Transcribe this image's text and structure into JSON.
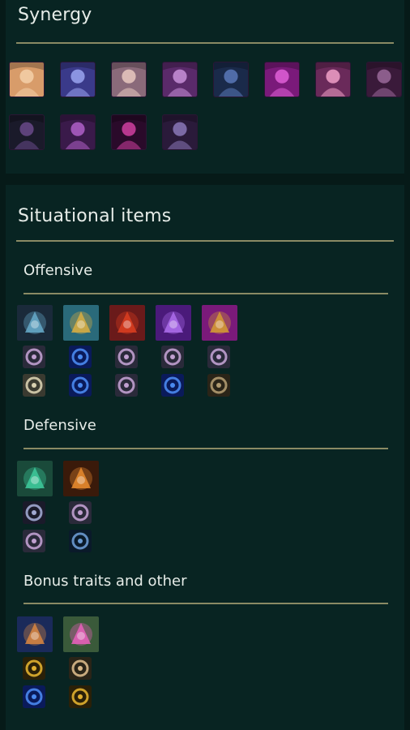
{
  "synergy": {
    "title": "Synergy",
    "champions": [
      {
        "icon": "champion-1-icon",
        "bg": "#d89c6a",
        "accent": "#f4d0a8"
      },
      {
        "icon": "champion-2-icon",
        "bg": "#3a3a8a",
        "accent": "#9aa4f0"
      },
      {
        "icon": "champion-3-icon",
        "bg": "#8a6a7a",
        "accent": "#e8c8c0"
      },
      {
        "icon": "champion-4-icon",
        "bg": "#5a2a6a",
        "accent": "#c890d8"
      },
      {
        "icon": "champion-5-icon",
        "bg": "#1a2a4a",
        "accent": "#5a78b8"
      },
      {
        "icon": "champion-6-icon",
        "bg": "#7a1a7a",
        "accent": "#e060d8"
      },
      {
        "icon": "champion-7-icon",
        "bg": "#6a2a5a",
        "accent": "#f0a0c8"
      },
      {
        "icon": "champion-8-icon",
        "bg": "#3a1a3a",
        "accent": "#9a6a9a"
      },
      {
        "icon": "champion-9-icon",
        "bg": "#1a1a2a",
        "accent": "#6a4a8a"
      },
      {
        "icon": "champion-10-icon",
        "bg": "#3a1a4a",
        "accent": "#b060c8"
      },
      {
        "icon": "champion-11-icon",
        "bg": "#2a0a2a",
        "accent": "#d040a0"
      },
      {
        "icon": "champion-12-icon",
        "bg": "#2a1a3a",
        "accent": "#8a78b8"
      }
    ]
  },
  "situational": {
    "title": "Situational items",
    "sections": [
      {
        "title": "Offensive",
        "items": [
          {
            "icon": "offensive-item-1-icon",
            "bg": "#1a2a3a",
            "accent": "#6ab0d0",
            "components": [
              {
                "icon": "sparring-gloves-icon",
                "bg": "#2a2a3a",
                "accent": "#c0a0d0"
              },
              {
                "icon": "chain-vest-icon",
                "bg": "#3a3a30",
                "accent": "#d8d0b0"
              }
            ]
          },
          {
            "icon": "offensive-item-2-icon",
            "bg": "#2a6a7a",
            "accent": "#e0b040",
            "components": [
              {
                "icon": "tear-of-the-goddess-icon",
                "bg": "#0a1a5a",
                "accent": "#4a8af0"
              },
              {
                "icon": "tear-of-the-goddess-icon",
                "bg": "#0a1a5a",
                "accent": "#4a8af0"
              }
            ]
          },
          {
            "icon": "offensive-item-3-icon",
            "bg": "#6a1a1a",
            "accent": "#e04020",
            "components": [
              {
                "icon": "sparring-gloves-icon",
                "bg": "#2a2a3a",
                "accent": "#c0a0d0"
              },
              {
                "icon": "sparring-gloves-icon",
                "bg": "#2a2a3a",
                "accent": "#c0a0d0"
              }
            ]
          },
          {
            "icon": "offensive-item-4-icon",
            "bg": "#4a1a7a",
            "accent": "#b070f0",
            "components": [
              {
                "icon": "sparring-gloves-icon",
                "bg": "#2a2a3a",
                "accent": "#c0a0d0"
              },
              {
                "icon": "tear-of-the-goddess-icon",
                "bg": "#0a1a5a",
                "accent": "#4a8af0"
              }
            ]
          },
          {
            "icon": "offensive-item-5-icon",
            "bg": "#7a1a7a",
            "accent": "#d8a030",
            "components": [
              {
                "icon": "sparring-gloves-icon",
                "bg": "#2a2a3a",
                "accent": "#c0a0d0"
              },
              {
                "icon": "giants-belt-icon",
                "bg": "#2a2418",
                "accent": "#b09a70"
              }
            ]
          }
        ]
      },
      {
        "title": "Defensive",
        "items": [
          {
            "icon": "defensive-item-1-icon",
            "bg": "#1a4a3a",
            "accent": "#40d0a0",
            "components": [
              {
                "icon": "bf-sword-icon",
                "bg": "#1a1a2a",
                "accent": "#a0a8d0"
              },
              {
                "icon": "sparring-gloves-icon",
                "bg": "#2a2a3a",
                "accent": "#c0a0d0"
              }
            ]
          },
          {
            "icon": "defensive-item-2-icon",
            "bg": "#3a1a0a",
            "accent": "#f09030",
            "components": [
              {
                "icon": "sparring-gloves-icon",
                "bg": "#2a2a3a",
                "accent": "#c0a0d0"
              },
              {
                "icon": "negatron-cloak-icon",
                "bg": "#0a1a2a",
                "accent": "#6a9ad0"
              }
            ]
          }
        ]
      },
      {
        "title": "Bonus traits and other",
        "items": [
          {
            "icon": "bonus-item-1-icon",
            "bg": "#1a2a5a",
            "accent": "#e08a40",
            "components": [
              {
                "icon": "spatula-icon",
                "bg": "#2a2008",
                "accent": "#e0b030"
              },
              {
                "icon": "tear-of-the-goddess-icon",
                "bg": "#0a1a5a",
                "accent": "#4a8af0"
              }
            ]
          },
          {
            "icon": "bonus-item-2-icon",
            "bg": "#3a5a3a",
            "accent": "#f060c0",
            "components": [
              {
                "icon": "shell-icon",
                "bg": "#2a2418",
                "accent": "#d8b888"
              },
              {
                "icon": "spatula-icon",
                "bg": "#2a2008",
                "accent": "#e0b030"
              }
            ]
          }
        ]
      }
    ]
  }
}
